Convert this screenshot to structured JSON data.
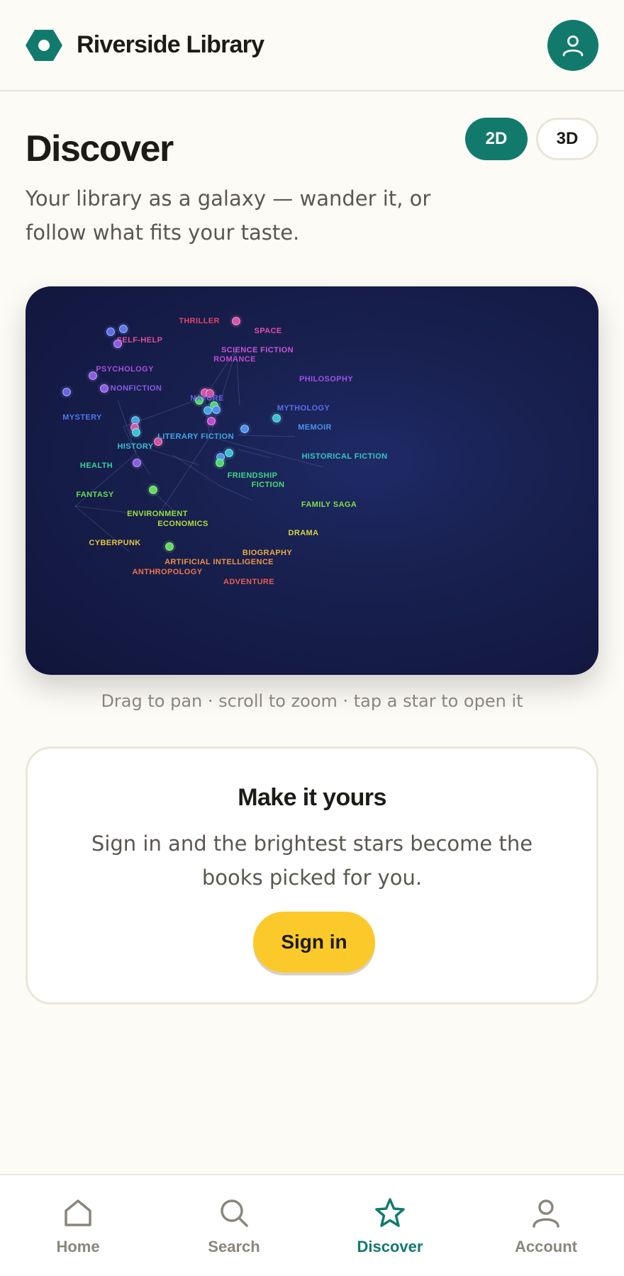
{
  "header": {
    "app_title": "Riverside Library",
    "logo_icon": "hexagon-logo-icon",
    "avatar_icon": "user-icon",
    "brand_color": "#127a6c"
  },
  "discover": {
    "title": "Discover",
    "subtitle": "Your library as a galaxy — wander it, or follow what fits your taste.",
    "toggle_2d": "2D",
    "toggle_3d": "3D",
    "active_mode": "2D"
  },
  "galaxy": {
    "background": "#141b45",
    "clusters": [
      {
        "name": "THRILLER",
        "color": "#e0446a"
      },
      {
        "name": "SPACE",
        "color": "#e24fa8"
      },
      {
        "name": "SELF-HELP",
        "color": "#d94fa0"
      },
      {
        "name": "SCIENCE FICTION",
        "color": "#c755d6"
      },
      {
        "name": "ROMANCE",
        "color": "#c24ad0"
      },
      {
        "name": "PSYCHOLOGY",
        "color": "#a64ee0"
      },
      {
        "name": "PHILOSOPHY",
        "color": "#9a52e6"
      },
      {
        "name": "NONFICTION",
        "color": "#8c5ae8"
      },
      {
        "name": "NATURE",
        "color": "#6a62ea"
      },
      {
        "name": "MYTHOLOGY",
        "color": "#5a6ef0"
      },
      {
        "name": "MYSTERY",
        "color": "#4e78ee"
      },
      {
        "name": "MEMOIR",
        "color": "#4a92ec"
      },
      {
        "name": "LITERARY FICTION",
        "color": "#3ea8e6"
      },
      {
        "name": "HISTORY",
        "color": "#35c2d8"
      },
      {
        "name": "HISTORICAL FICTION",
        "color": "#32c9c0"
      },
      {
        "name": "HEALTH",
        "color": "#35d39c"
      },
      {
        "name": "FRIENDSHIP",
        "color": "#3ed884"
      },
      {
        "name": "FICTION",
        "color": "#48dc6e"
      },
      {
        "name": "FANTASY",
        "color": "#62de56"
      },
      {
        "name": "FAMILY SAGA",
        "color": "#7ee046"
      },
      {
        "name": "ENVIRONMENT",
        "color": "#9ae03e"
      },
      {
        "name": "ECONOMICS",
        "color": "#b6dc3a"
      },
      {
        "name": "DRAMA",
        "color": "#d4d43a"
      },
      {
        "name": "CYBERPUNK",
        "color": "#e6c43c"
      },
      {
        "name": "BIOGRAPHY",
        "color": "#eeaa40"
      },
      {
        "name": "ARTIFICIAL INTELLIGENCE",
        "color": "#f09044"
      },
      {
        "name": "ANTHROPOLOGY",
        "color": "#f0744a"
      },
      {
        "name": "ADVENTURE",
        "color": "#ec5a52"
      }
    ]
  },
  "hint": "Drag to pan · scroll to zoom · tap a star to open it",
  "promo": {
    "title": "Make it yours",
    "text": "Sign in and the brightest stars become the books picked for you.",
    "signin_label": "Sign in",
    "accent": "#fcc92b"
  },
  "nav": {
    "items": [
      {
        "label": "Home",
        "icon": "home-icon",
        "active": false
      },
      {
        "label": "Search",
        "icon": "search-icon",
        "active": false
      },
      {
        "label": "Discover",
        "icon": "star-icon",
        "active": true
      },
      {
        "label": "Account",
        "icon": "user-icon",
        "active": false
      }
    ]
  }
}
